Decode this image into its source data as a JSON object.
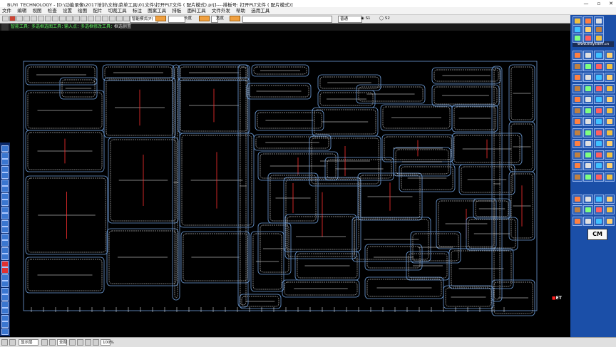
{
  "window": {
    "title": "BUYI_TECHNOLOGY - [D:\\功能录像\\2017培训\\文档\\菜单工具\\01文件\\打开PLT文件 ( 配片模式).prj]----排板号: 打开PLT文件 ( 配片模式)]",
    "controls": [
      "—",
      "▫",
      "✕"
    ]
  },
  "menu": {
    "items": [
      "文件",
      "编辑",
      "视图",
      "检查",
      "设置",
      "绘图",
      "配片",
      "切裁工具",
      "标注",
      "图案工具",
      "排板",
      "面料工具",
      "文件外发",
      "帮助",
      "选用工具"
    ]
  },
  "toolbar": {
    "mode_select": "智能模式(P)",
    "length_label": "长度",
    "width_label": "宽度",
    "quality_select": "普通",
    "radio1": "S1",
    "radio2": "S2"
  },
  "statusline": {
    "text1": "智能工具：",
    "text2": "多选框选图工具：",
    "text3": "输入点：",
    "text4": "多选框修改工具：",
    "text5": "框选删置"
  },
  "right_panel": {
    "logo_text": "www.etsystem.cn",
    "cm_label": "CM"
  },
  "canvas": {
    "corner_label": "ET"
  },
  "bottombar": {
    "layer_select": "显示层",
    "view_select": "全部",
    "zoom_value": "100%"
  },
  "colors": {
    "piece_outline": "#6d9cd6",
    "seam_line": "#ffffff",
    "grain_line": "#ff3030",
    "accent_red": "#ff2020",
    "panel_blue": "#1b4fa8"
  }
}
